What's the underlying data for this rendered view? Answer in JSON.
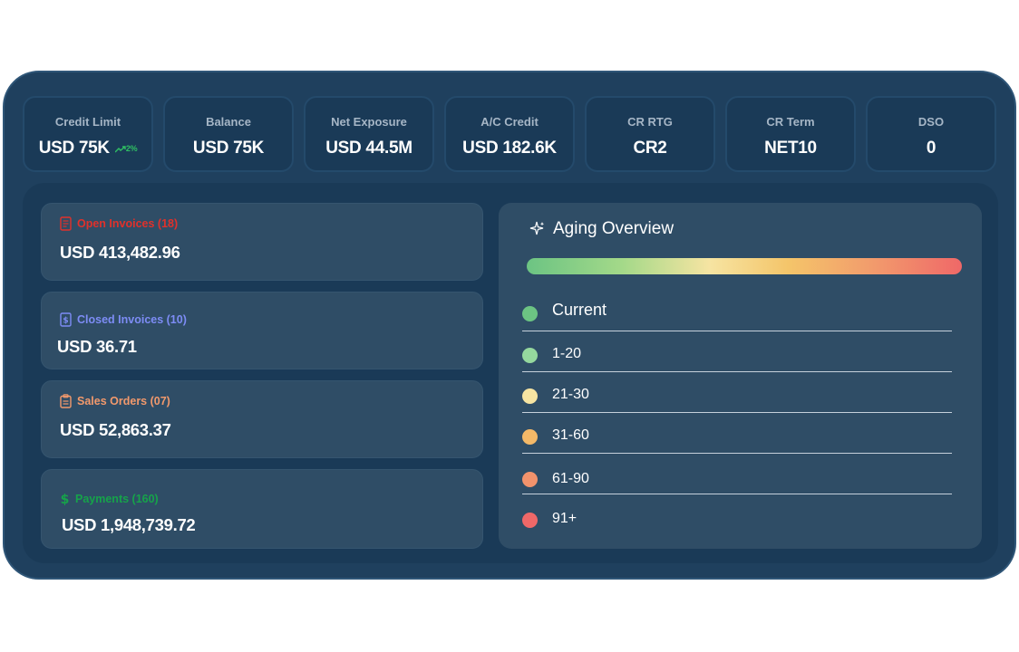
{
  "metrics": [
    {
      "label": "Credit Limit",
      "value": "USD 75K",
      "trend": "2%"
    },
    {
      "label": "Balance",
      "value": "USD 75K"
    },
    {
      "label": "Net Exposure",
      "value": "USD 44.5M"
    },
    {
      "label": "A/C Credit",
      "value": "USD 182.6K"
    },
    {
      "label": "CR RTG",
      "value": "CR2"
    },
    {
      "label": "CR Term",
      "value": "NET10"
    },
    {
      "label": "DSO",
      "value": "0"
    }
  ],
  "cards": [
    {
      "title": "Open Invoices (18)",
      "amount": "USD 413,482.96",
      "color": "#e0312b",
      "icon": "document-icon"
    },
    {
      "title": "Closed Invoices (10)",
      "amount": "USD 36.71",
      "color": "#7d8cf5",
      "icon": "receipt-icon"
    },
    {
      "title": "Sales Orders (07)",
      "amount": "USD 52,863.37",
      "color": "#f2996c",
      "icon": "clipboard-icon"
    },
    {
      "title": "Payments (160)",
      "amount": "USD 1,948,739.72",
      "color": "#16a34a",
      "icon": "dollar-icon"
    }
  ],
  "aging": {
    "title": "Aging Overview",
    "icon": "sparkle-icon",
    "buckets": [
      {
        "label": "Current",
        "color": "#6cc483"
      },
      {
        "label": "1-20",
        "color": "#95d89e"
      },
      {
        "label": "21-30",
        "color": "#f6e4a2"
      },
      {
        "label": "31-60",
        "color": "#f4b968"
      },
      {
        "label": "61-90",
        "color": "#f2936c"
      },
      {
        "label": "91+",
        "color": "#ef6868"
      }
    ]
  }
}
